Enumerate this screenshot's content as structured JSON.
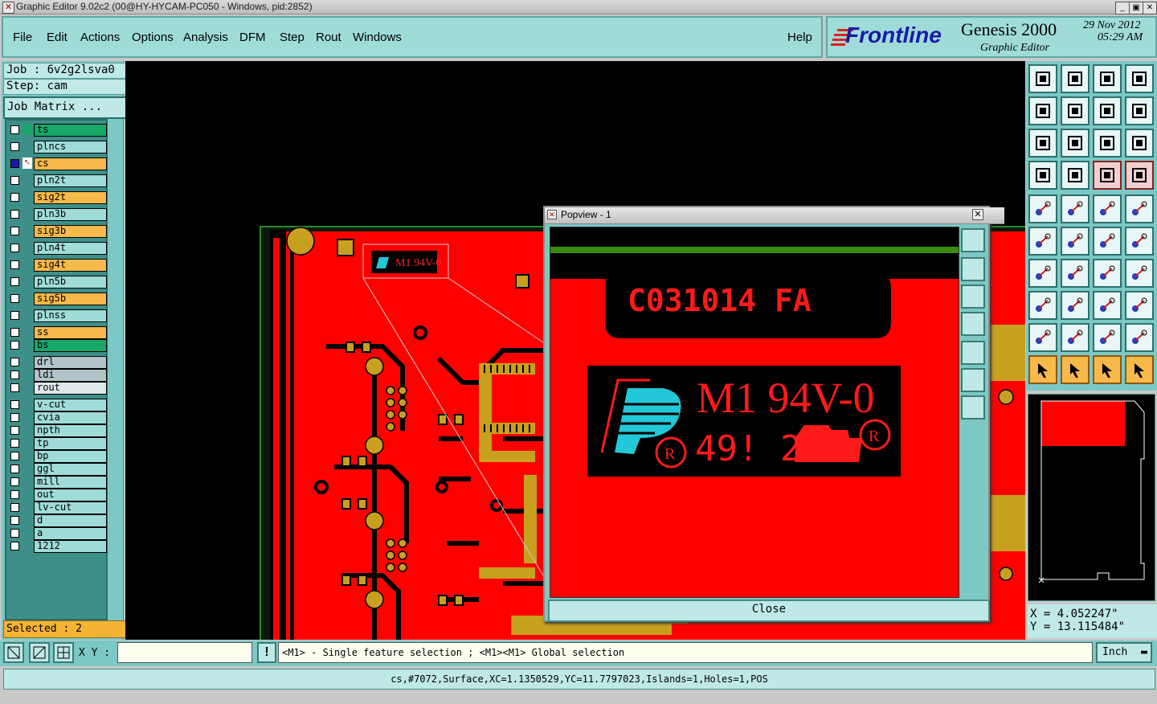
{
  "window": {
    "title": "Graphic Editor 9.02c2 (00@HY-HYCAM-PC050 - Windows, pid:2852)"
  },
  "menu": {
    "items": [
      "File",
      "Edit",
      "Actions",
      "Options",
      "Analysis",
      "DFM",
      "Step",
      "Rout",
      "Windows"
    ],
    "help": "Help"
  },
  "brand": {
    "logo": "Frontline",
    "product": "Genesis 2000",
    "subtitle": "Graphic Editor",
    "date": "29 Nov 2012",
    "time": "05:29 AM"
  },
  "job": {
    "job_label": "Job : 6v2g2lsva0",
    "step_label": "Step: cam",
    "matrix_button": "Job Matrix ..."
  },
  "layers": [
    {
      "name": "ts",
      "color": "#1aa86a",
      "active": false
    },
    {
      "name": "plncs",
      "color": "#9fdcd8",
      "active": false
    },
    {
      "name": "cs",
      "color": "#f7b94a",
      "active": true
    },
    {
      "name": "pln2t",
      "color": "#9fdcd8",
      "active": false
    },
    {
      "name": "sig2t",
      "color": "#f7b94a",
      "active": false
    },
    {
      "name": "pln3b",
      "color": "#9fdcd8",
      "active": false
    },
    {
      "name": "sig3b",
      "color": "#f7b94a",
      "active": false
    },
    {
      "name": "pln4t",
      "color": "#9fdcd8",
      "active": false
    },
    {
      "name": "sig4t",
      "color": "#f7b94a",
      "active": false
    },
    {
      "name": "pln5b",
      "color": "#9fdcd8",
      "active": false
    },
    {
      "name": "sig5b",
      "color": "#f7b94a",
      "active": false
    },
    {
      "name": "plnss",
      "color": "#9fdcd8",
      "active": false
    },
    {
      "name": "ss",
      "color": "#f7b94a",
      "active": false
    },
    {
      "name": "bs",
      "color": "#1aa86a",
      "active": false
    },
    {
      "name": "drl",
      "color": "#b3c4c8",
      "active": false
    },
    {
      "name": "ldi",
      "color": "#b3c4c8",
      "active": false
    },
    {
      "name": "rout",
      "color": "#dfe7e8",
      "active": false
    },
    {
      "name": "v-cut",
      "color": "#9fdcd8",
      "active": false
    },
    {
      "name": "cvia",
      "color": "#9fdcd8",
      "active": false
    },
    {
      "name": "npth",
      "color": "#9fdcd8",
      "active": false
    },
    {
      "name": "tp",
      "color": "#9fdcd8",
      "active": false
    },
    {
      "name": "bp",
      "color": "#9fdcd8",
      "active": false
    },
    {
      "name": "ggl",
      "color": "#9fdcd8",
      "active": false
    },
    {
      "name": "mill",
      "color": "#9fdcd8",
      "active": false
    },
    {
      "name": "out",
      "color": "#9fdcd8",
      "active": false
    },
    {
      "name": "lv-cut",
      "color": "#9fdcd8",
      "active": false
    },
    {
      "name": "d",
      "color": "#9fdcd8",
      "active": false
    },
    {
      "name": "a",
      "color": "#9fdcd8",
      "active": false
    },
    {
      "name": "1212",
      "color": "#9fdcd8",
      "active": false
    }
  ],
  "selected": "Selected : 2",
  "popview": {
    "title": "Popview - 1",
    "close_label": "Close",
    "board_text": "C031014  FA",
    "marking_main": "M1 94V-0",
    "marking_digits": "49! 2"
  },
  "board": {
    "silk_text": "C031014 FA"
  },
  "coords": {
    "x": "X = 4.052247\"",
    "y": "Y = 13.115484\""
  },
  "bottom": {
    "xy_label": "X Y :",
    "xy_value": "",
    "hint": "<M1> - Single feature selection ; <M1><M1> Global selection",
    "units": "Inch"
  },
  "status": {
    "text": "cs,#7072,Surface,XC=1.1350529,YC=11.7797023,Islands=1,Holes=1,POS"
  },
  "colors": {
    "panel": "#7bc8c4",
    "panel_light": "#bfe9e6",
    "copper": "#ff0000",
    "pad": "#c8a020",
    "accent_orange": "#f7b94a"
  }
}
